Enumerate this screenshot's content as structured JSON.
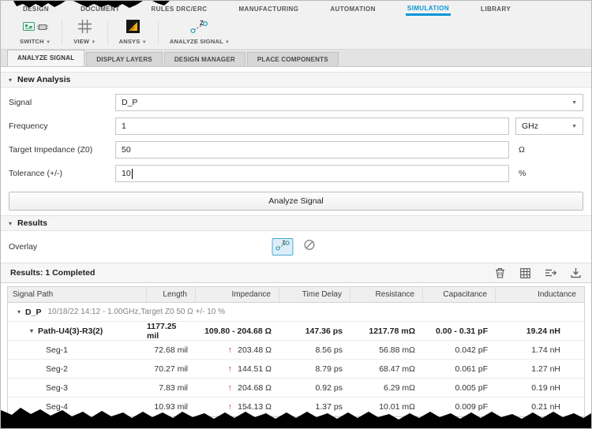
{
  "ribbon": {
    "tabs": [
      {
        "label": "DESIGN"
      },
      {
        "label": "DOCUMENT"
      },
      {
        "label": "RULES DRC/ERC"
      },
      {
        "label": "MANUFACTURING"
      },
      {
        "label": "AUTOMATION"
      },
      {
        "label": "SIMULATION",
        "active": true
      },
      {
        "label": "LIBRARY"
      }
    ],
    "tools": [
      {
        "label": "SWITCH"
      },
      {
        "label": "VIEW"
      },
      {
        "label": "ANSYS"
      },
      {
        "label": "ANALYZE SIGNAL"
      }
    ]
  },
  "panel_tabs": [
    {
      "label": "ANALYZE SIGNAL",
      "active": true
    },
    {
      "label": "DISPLAY LAYERS"
    },
    {
      "label": "DESIGN MANAGER"
    },
    {
      "label": "PLACE COMPONENTS"
    }
  ],
  "new_analysis": {
    "title": "New Analysis",
    "signal_label": "Signal",
    "signal_value": "D_P",
    "frequency_label": "Frequency",
    "frequency_value": "1",
    "frequency_unit": "GHz",
    "impedance_label": "Target Impedance (Z0)",
    "impedance_value": "50",
    "impedance_unit": "Ω",
    "tolerance_label": "Tolerance (+/-)",
    "tolerance_value": "10",
    "tolerance_unit": "%",
    "analyze_button": "Analyze Signal"
  },
  "results": {
    "title": "Results",
    "overlay_label": "Overlay",
    "status": "Results: 1 Completed",
    "table": {
      "columns": [
        "Signal Path",
        "Length",
        "Impedance",
        "Time Delay",
        "Resistance",
        "Capacitance",
        "Inductance"
      ],
      "group_name": "D_P",
      "group_meta": "10/18/22 14:12 - 1.00GHz,Target Z0 50 Ω +/- 10 %",
      "path": {
        "name": "Path-U4(3)-R3(2)",
        "length": "1177.25 mil",
        "impedance": "109.80 - 204.68 Ω",
        "time_delay": "147.36 ps",
        "resistance": "1217.78 mΩ",
        "capacitance": "0.00 - 0.31 pF",
        "inductance": "19.24 nH"
      },
      "segments": [
        {
          "name": "Seg-1",
          "length": "72.68 mil",
          "impedance": "203.48 Ω",
          "time_delay": "8.56 ps",
          "resistance": "56.88 mΩ",
          "capacitance": "0.042 pF",
          "inductance": "1.74 nH"
        },
        {
          "name": "Seg-2",
          "length": "70.27 mil",
          "impedance": "144.51 Ω",
          "time_delay": "8.79 ps",
          "resistance": "68.47 mΩ",
          "capacitance": "0.061 pF",
          "inductance": "1.27 nH"
        },
        {
          "name": "Seg-3",
          "length": "7.83 mil",
          "impedance": "204.68 Ω",
          "time_delay": "0.92 ps",
          "resistance": "6.29 mΩ",
          "capacitance": "0.005 pF",
          "inductance": "0.19 nH"
        },
        {
          "name": "Seg-4",
          "length": "10.93 mil",
          "impedance": "154.13 Ω",
          "time_delay": "1.37 ps",
          "resistance": "10.01 mΩ",
          "capacitance": "0.009 pF",
          "inductance": "0.21 nH"
        }
      ]
    }
  },
  "colors": {
    "accent": "#0a96d8",
    "alert": "#d84040",
    "ansys_gold": "#f2b01e"
  }
}
